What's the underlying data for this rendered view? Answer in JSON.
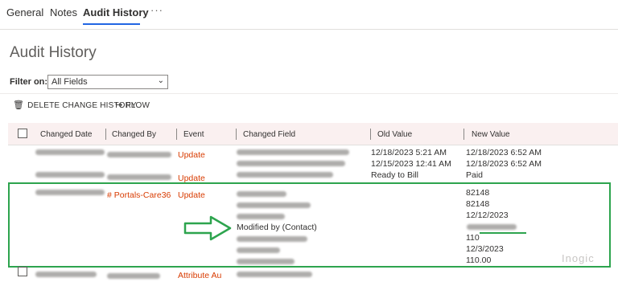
{
  "tabs": [
    {
      "label": "General"
    },
    {
      "label": "Notes"
    },
    {
      "label": "Audit History"
    }
  ],
  "more_label": "···",
  "page_title": "Audit History",
  "filter": {
    "label": "Filter on:",
    "value": "All Fields"
  },
  "commands": {
    "delete_label": "DELETE CHANGE HISTORY",
    "flow_label": "FLOW"
  },
  "columns": [
    "Changed Date",
    "Changed By",
    "Event",
    "Changed Field",
    "Old Value",
    "New Value"
  ],
  "rows": [
    {
      "event": "Update",
      "old_values": [
        "12/18/2023 5:21 AM",
        "12/15/2023 12:41 AM"
      ],
      "new_values": [
        "12/18/2023 6:52 AM",
        "12/18/2023 6:52 AM"
      ]
    },
    {
      "event": "Update",
      "old_values": [
        "Ready to Bill"
      ],
      "new_values": [
        "Paid"
      ]
    },
    {
      "changed_by": "# Portals-Care36",
      "event": "Update",
      "fields_visible": [
        "Modified by (Contact)"
      ],
      "new_values": [
        "82148",
        "82148",
        "12/12/2023",
        "110",
        "12/3/2023",
        "110.00"
      ]
    },
    {
      "event": "Attribute Au"
    }
  ],
  "watermark": "Inogic",
  "colors": {
    "accent": "#2266e3",
    "event": "#d83b01",
    "highlight": "#2da44e",
    "header_bg": "#faf0f0"
  }
}
